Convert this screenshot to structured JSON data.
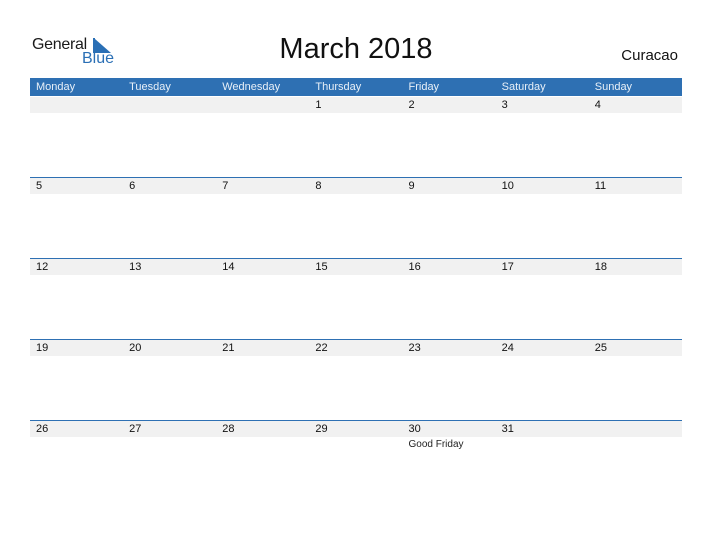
{
  "logo": {
    "general": "General",
    "blue": "Blue"
  },
  "title": "March 2018",
  "country": "Curacao",
  "colors": {
    "accent": "#2e70b3",
    "row_strip": "#f1f1f1"
  },
  "weekdays": [
    "Monday",
    "Tuesday",
    "Wednesday",
    "Thursday",
    "Friday",
    "Saturday",
    "Sunday"
  ],
  "weeks": [
    {
      "days": [
        {
          "n": ""
        },
        {
          "n": ""
        },
        {
          "n": ""
        },
        {
          "n": "1"
        },
        {
          "n": "2"
        },
        {
          "n": "3"
        },
        {
          "n": "4"
        }
      ]
    },
    {
      "days": [
        {
          "n": "5"
        },
        {
          "n": "6"
        },
        {
          "n": "7"
        },
        {
          "n": "8"
        },
        {
          "n": "9"
        },
        {
          "n": "10"
        },
        {
          "n": "11"
        }
      ]
    },
    {
      "days": [
        {
          "n": "12"
        },
        {
          "n": "13"
        },
        {
          "n": "14"
        },
        {
          "n": "15"
        },
        {
          "n": "16"
        },
        {
          "n": "17"
        },
        {
          "n": "18"
        }
      ]
    },
    {
      "days": [
        {
          "n": "19"
        },
        {
          "n": "20"
        },
        {
          "n": "21"
        },
        {
          "n": "22"
        },
        {
          "n": "23"
        },
        {
          "n": "24"
        },
        {
          "n": "25"
        }
      ]
    },
    {
      "days": [
        {
          "n": "26"
        },
        {
          "n": "27"
        },
        {
          "n": "28"
        },
        {
          "n": "29"
        },
        {
          "n": "30",
          "event": "Good Friday"
        },
        {
          "n": "31"
        },
        {
          "n": ""
        }
      ]
    }
  ]
}
